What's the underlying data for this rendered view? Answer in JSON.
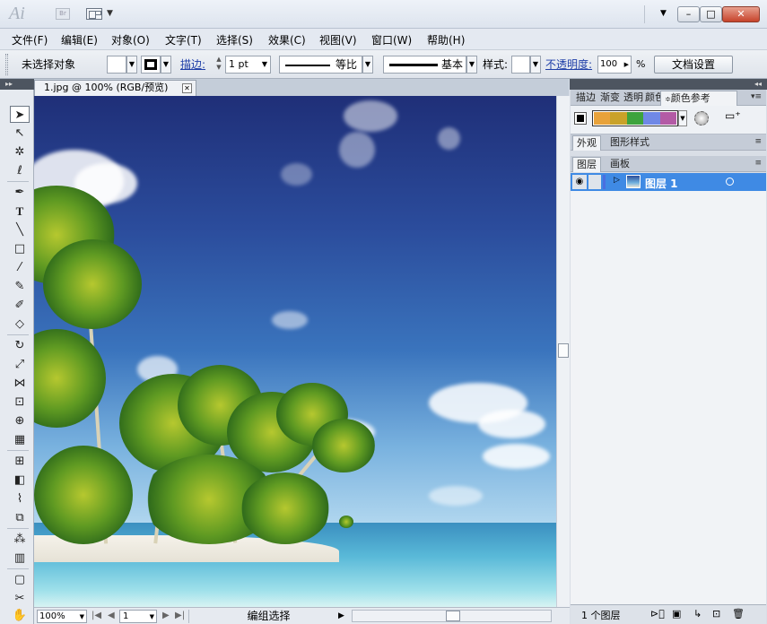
{
  "title_bar": {
    "app_logo": "Ai",
    "bridge_label": "Br",
    "minimize": "–",
    "maximize": "□",
    "close": "✕"
  },
  "menu": [
    "文件(F)",
    "编辑(E)",
    "对象(O)",
    "文字(T)",
    "选择(S)",
    "效果(C)",
    "视图(V)",
    "窗口(W)",
    "帮助(H)"
  ],
  "control_bar": {
    "selection_status": "未选择对象",
    "stroke_label": "描边:",
    "stroke_weight": "1 pt",
    "variable_width_profile": "等比",
    "brush_definition": "基本",
    "style_label": "样式:",
    "opacity_label": "不透明度:",
    "opacity_value": "100",
    "opacity_unit": "%",
    "document_setup": "文档设置"
  },
  "document_tab": {
    "title": "1.jpg @ 100% (RGB/预览)",
    "close": "✕"
  },
  "status_bar": {
    "zoom": "100%",
    "artboard_number": "1",
    "status_text": "编组选择"
  },
  "panels": {
    "top_tabs": [
      "描边",
      "渐变",
      "透明",
      "颜色",
      "颜色参考"
    ],
    "middle_tabs": [
      "外观",
      "图形样式"
    ],
    "layers_tabs": [
      "图层",
      "画板"
    ],
    "harmony_colors": [
      "#e8a23a",
      "#c9a229",
      "#3da33c",
      "#6f88e6",
      "#b35aa5"
    ],
    "layer_name": "图层 1",
    "layer_count": "1 个图层"
  },
  "toolbox_icons": [
    "selection-tool-icon",
    "direct-selection-tool-icon",
    "magic-wand-tool-icon",
    "lasso-tool-icon",
    "pen-tool-icon",
    "type-tool-icon",
    "line-segment-tool-icon",
    "rectangle-tool-icon",
    "paintbrush-tool-icon",
    "pencil-tool-icon",
    "blob-brush-tool-icon",
    "eraser-tool-icon",
    "rotate-tool-icon",
    "scale-tool-icon",
    "width-tool-icon",
    "free-transform-tool-icon",
    "shape-builder-tool-icon",
    "perspective-grid-tool-icon",
    "mesh-tool-icon",
    "gradient-tool-icon",
    "eyedropper-tool-icon",
    "blend-tool-icon",
    "symbol-sprayer-tool-icon",
    "column-graph-tool-icon",
    "artboard-tool-icon",
    "slice-tool-icon",
    "hand-tool-icon"
  ]
}
